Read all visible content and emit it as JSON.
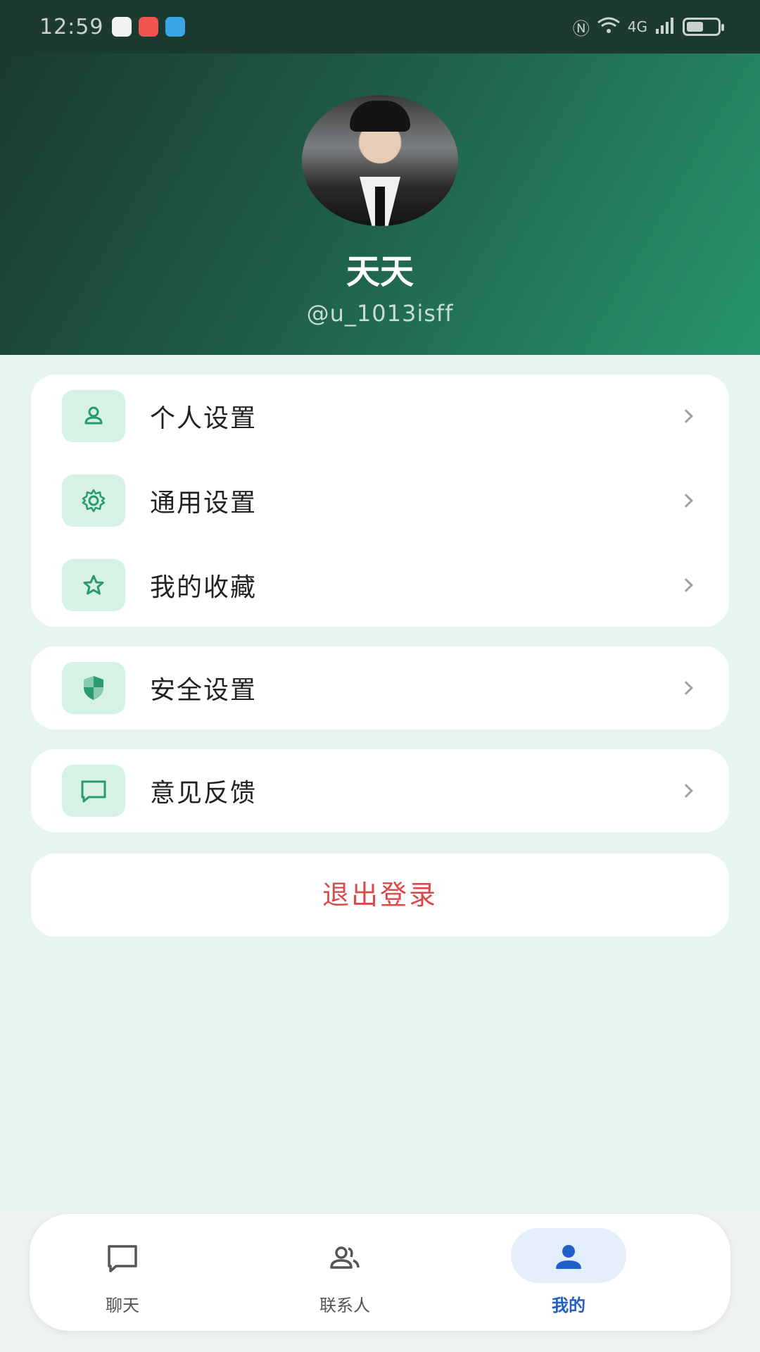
{
  "status_bar": {
    "time": "12:59",
    "signal_text": "4G"
  },
  "profile": {
    "name": "天天",
    "handle": "@u_1013isff"
  },
  "menu_group_1": [
    {
      "label": "个人设置",
      "icon": "person-icon"
    },
    {
      "label": "通用设置",
      "icon": "gear-icon"
    },
    {
      "label": "我的收藏",
      "icon": "star-icon"
    }
  ],
  "menu_group_2": [
    {
      "label": "安全设置",
      "icon": "shield-icon"
    }
  ],
  "menu_group_3": [
    {
      "label": "意见反馈",
      "icon": "feedback-icon"
    }
  ],
  "logout": {
    "label": "退出登录"
  },
  "bottom_nav": [
    {
      "label": "聊天",
      "icon": "chat-icon",
      "active": false
    },
    {
      "label": "联系人",
      "icon": "contacts-icon",
      "active": false
    },
    {
      "label": "我的",
      "icon": "profile-icon",
      "active": true
    }
  ],
  "colors": {
    "accent": "#2a9a70",
    "danger": "#d94a4a",
    "nav_active": "#1f5fc7",
    "icon_bg": "#d5f2e5"
  }
}
